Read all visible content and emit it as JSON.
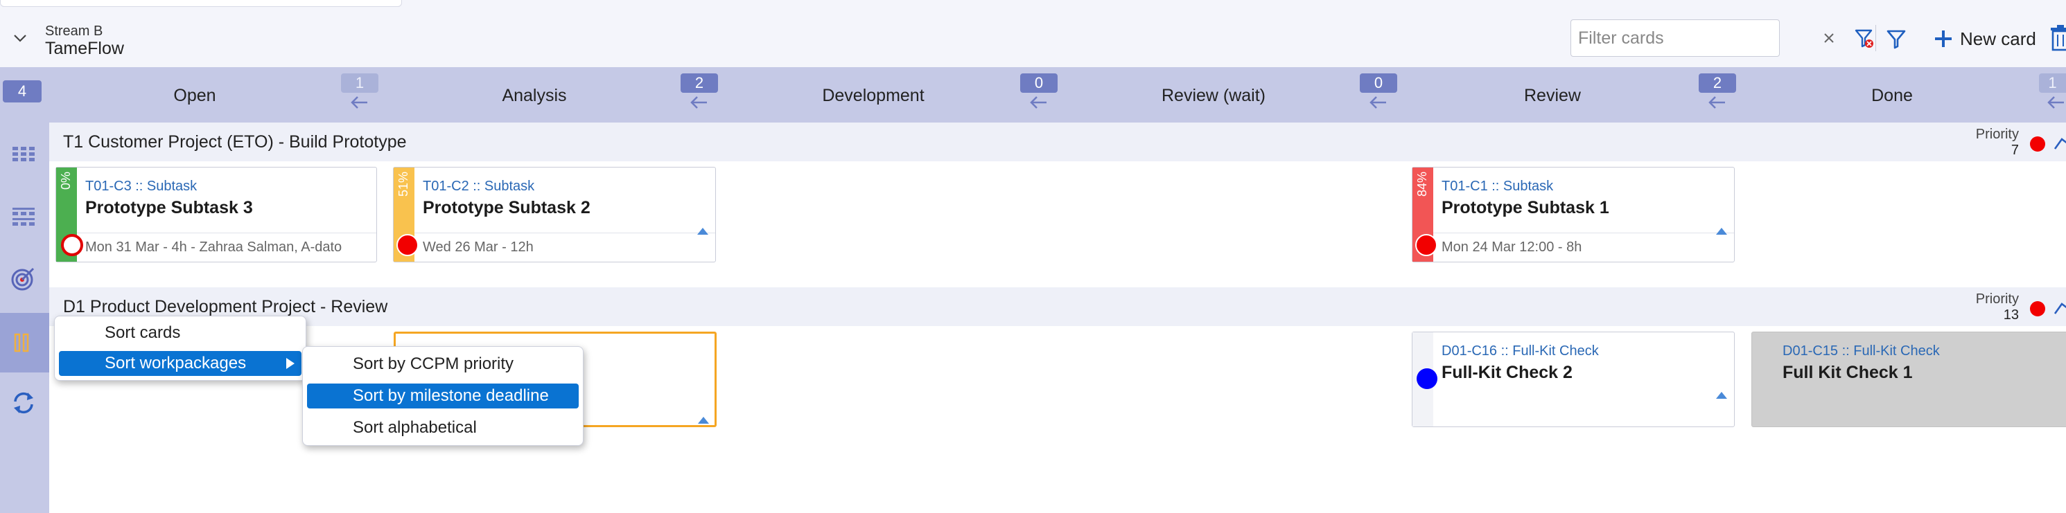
{
  "header": {
    "stream_label": "Stream B",
    "board_title": "TameFlow",
    "filter_placeholder": "Filter cards",
    "new_card_label": "New card"
  },
  "columns": {
    "total_count": "4",
    "items": [
      {
        "title": "Open"
      },
      {
        "title": "Analysis",
        "wip_before": "1"
      },
      {
        "title": "Development",
        "wip_before": "2"
      },
      {
        "title": "Review (wait)",
        "wip_before": "0"
      },
      {
        "title": "Review",
        "wip_before": "0"
      },
      {
        "title": "Done",
        "wip_before": "2"
      }
    ],
    "last_wip": "1"
  },
  "lanes": [
    {
      "title": "T1 Customer Project (ETO) - Build Prototype",
      "priority_label": "Priority",
      "priority_value": "7",
      "cards": [
        {
          "id": "T01-C3 :: Subtask",
          "title": "Prototype Subtask 3",
          "meta": "Mon 31 Mar - 4h - Zahraa Salman, A-dato",
          "progress": "0%",
          "strip_color": "#4caf50",
          "status_color": "#ffffff",
          "status_ring": "#e00000"
        },
        {
          "id": "T01-C2 :: Subtask",
          "title": "Prototype Subtask 2",
          "meta": "Wed 26 Mar - 12h",
          "progress": "51%",
          "strip_color": "#f9c24e",
          "status_color": "#f20000",
          "status_ring": "#ffffff"
        },
        {
          "id": "T01-C1 :: Subtask",
          "title": "Prototype Subtask 1",
          "meta": "Mon 24 Mar 12:00 - 8h",
          "progress": "84%",
          "strip_color": "#f25555",
          "status_color": "#f20000",
          "status_ring": "#ffffff"
        }
      ]
    },
    {
      "title": "D1 Product Development Project - Review",
      "priority_label": "Priority",
      "priority_value": "13",
      "cards": [
        {
          "id": "D01-C16 :: Full-Kit Check",
          "title": "Full-Kit Check 2",
          "status_color": "#0000ff"
        },
        {
          "id": "D01-C15 :: Full-Kit Check",
          "title": "Full Kit Check 1"
        }
      ]
    }
  ],
  "context_menu": {
    "items": [
      {
        "label": "Sort cards"
      },
      {
        "label": "Sort workpackages",
        "has_submenu": true
      }
    ],
    "submenu": [
      {
        "label": "Sort by CCPM priority"
      },
      {
        "label": "Sort by milestone deadline"
      },
      {
        "label": "Sort alphabetical"
      }
    ]
  },
  "colors": {
    "accent": "#0a73d2",
    "header_band": "#c5c9e6",
    "badge": "#6f7cc2",
    "id_text": "#2a68b5",
    "selected_card_border": "#f5a623",
    "done_card": "#cfcfcf"
  }
}
